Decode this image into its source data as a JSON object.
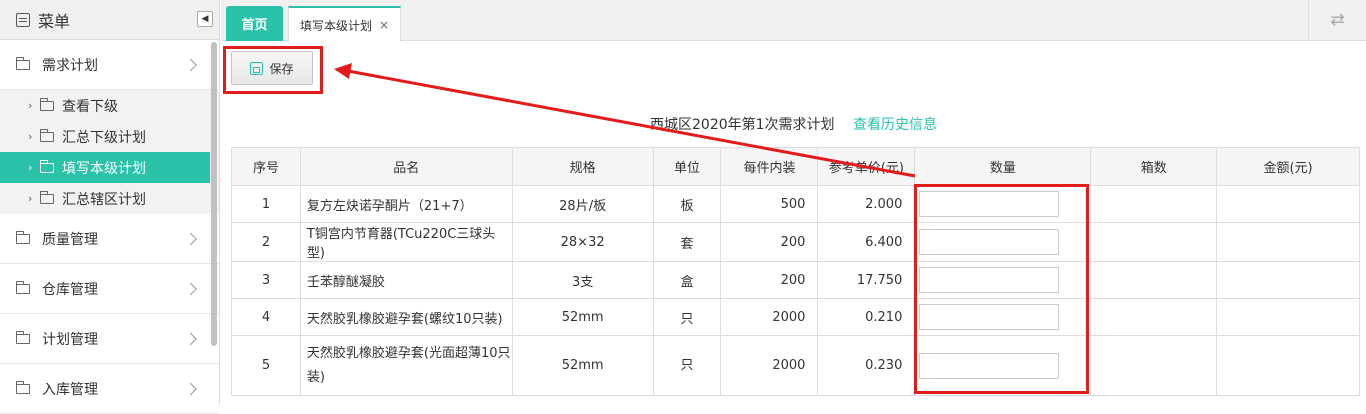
{
  "sidebar": {
    "title": "菜单",
    "groups": [
      {
        "label": "需求计划"
      },
      {
        "label": "质量管理"
      },
      {
        "label": "仓库管理"
      },
      {
        "label": "计划管理"
      },
      {
        "label": "入库管理"
      }
    ],
    "sub_items": [
      {
        "label": "查看下级"
      },
      {
        "label": "汇总下级计划"
      },
      {
        "label": "填写本级计划"
      },
      {
        "label": "汇总辖区计划"
      }
    ],
    "active_item": "填写本级计划"
  },
  "tabs": {
    "home": "首页",
    "current": "填写本级计划",
    "close": "×"
  },
  "toolbar": {
    "save_label": "保存"
  },
  "page": {
    "title": "西城区2020年第1次需求计划",
    "history_link": "查看历史信息"
  },
  "table": {
    "headers": [
      "序号",
      "品名",
      "规格",
      "单位",
      "每件内装",
      "参考单价(元)",
      "数量",
      "箱数",
      "金额(元)"
    ],
    "rows": [
      {
        "no": "1",
        "name": "复方左炔诺孕酮片（21+7）",
        "spec": "28片/板",
        "unit": "板",
        "pack": "500",
        "price": "2.000"
      },
      {
        "no": "2",
        "name": "T铜宫内节育器(TCu220C三球头型)",
        "spec": "28×32",
        "unit": "套",
        "pack": "200",
        "price": "6.400"
      },
      {
        "no": "3",
        "name": "壬苯醇醚凝胶",
        "spec": "3支",
        "unit": "盒",
        "pack": "200",
        "price": "17.750"
      },
      {
        "no": "4",
        "name": "天然胶乳橡胶避孕套(螺纹10只装)",
        "spec": "52mm",
        "unit": "只",
        "pack": "2000",
        "price": "0.210"
      },
      {
        "no": "5",
        "name": "天然胶乳橡胶避孕套(光面超薄10只装)",
        "spec": "52mm",
        "unit": "只",
        "pack": "2000",
        "price": "0.230"
      }
    ]
  },
  "colors": {
    "accent": "#2ac3a9",
    "annotation": "#e21b1b"
  }
}
